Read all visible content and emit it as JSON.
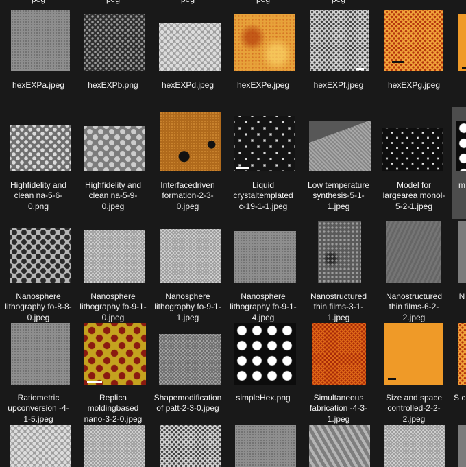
{
  "partial_labels_top": [
    "peg",
    "peg",
    "peg",
    "peg",
    "peg"
  ],
  "files": [
    {
      "label": "hexEXPa.jpeg",
      "icon": "image-thumbnail"
    },
    {
      "label": "hexEXPb.png",
      "icon": "image-thumbnail"
    },
    {
      "label": "hexEXPd.jpeg",
      "icon": "image-thumbnail"
    },
    {
      "label": "hexEXPe.jpeg",
      "icon": "image-thumbnail"
    },
    {
      "label": "hexEXPf.jpeg",
      "icon": "image-thumbnail"
    },
    {
      "label": "hexEXPg.jpeg",
      "icon": "image-thumbnail"
    },
    {
      "label": "",
      "icon": "image-thumbnail"
    },
    {
      "label": "Highfidelity and clean na-5-6-0.png",
      "icon": "image-thumbnail"
    },
    {
      "label": "Highfidelity and clean na-5-9-0.jpeg",
      "icon": "image-thumbnail"
    },
    {
      "label": "Interfacedriven formation-2-3-0.jpeg",
      "icon": "image-thumbnail"
    },
    {
      "label": "Liquid crystaltemplated c-19-1-1.jpeg",
      "icon": "image-thumbnail"
    },
    {
      "label": "Low temperature synthesis-5-1-1.jpeg",
      "icon": "image-thumbnail"
    },
    {
      "label": "Model for largearea monol-5-2-1.jpeg",
      "icon": "image-thumbnail"
    },
    {
      "label": "m",
      "icon": "image-thumbnail"
    },
    {
      "label": "Nanosphere lithography fo-8-8-0.jpeg",
      "icon": "image-thumbnail"
    },
    {
      "label": "Nanosphere lithography fo-9-1-0.jpeg",
      "icon": "image-thumbnail"
    },
    {
      "label": "Nanosphere lithography fo-9-1-1.jpeg",
      "icon": "image-thumbnail"
    },
    {
      "label": "Nanosphere lithography fo-9-1-4.jpeg",
      "icon": "image-thumbnail"
    },
    {
      "label": "Nanostructured thin films-3-1-1.jpeg",
      "icon": "image-thumbnail"
    },
    {
      "label": "Nanostructured thin films-6-2-2.jpeg",
      "icon": "image-thumbnail"
    },
    {
      "label": "N",
      "icon": "image-thumbnail"
    },
    {
      "label": "Ratiometric upconversion -4-1-5.jpeg",
      "icon": "image-thumbnail"
    },
    {
      "label": "Replica moldingbased nano-3-2-0.jpeg",
      "icon": "image-thumbnail"
    },
    {
      "label": "Shapemodification of patt-2-3-0.jpeg",
      "icon": "image-thumbnail"
    },
    {
      "label": "simpleHex.png",
      "icon": "image-thumbnail"
    },
    {
      "label": "Simultaneous fabrication -4-3-1.jpeg",
      "icon": "image-thumbnail"
    },
    {
      "label": "Size and space controlled-2-2-2.jpeg",
      "icon": "image-thumbnail"
    },
    {
      "label": "S co",
      "icon": "image-thumbnail"
    },
    {
      "label": "",
      "icon": "image-thumbnail"
    },
    {
      "label": "",
      "icon": "image-thumbnail"
    },
    {
      "label": "",
      "icon": "image-thumbnail"
    },
    {
      "label": "",
      "icon": "image-thumbnail"
    },
    {
      "label": "",
      "icon": "image-thumbnail"
    },
    {
      "label": "",
      "icon": "image-thumbnail"
    },
    {
      "label": "",
      "icon": "image-thumbnail"
    }
  ],
  "selected_index": 13,
  "colors": {
    "background": "#191919",
    "selection": "#4d4d4d",
    "text": "#f0f0f0"
  }
}
